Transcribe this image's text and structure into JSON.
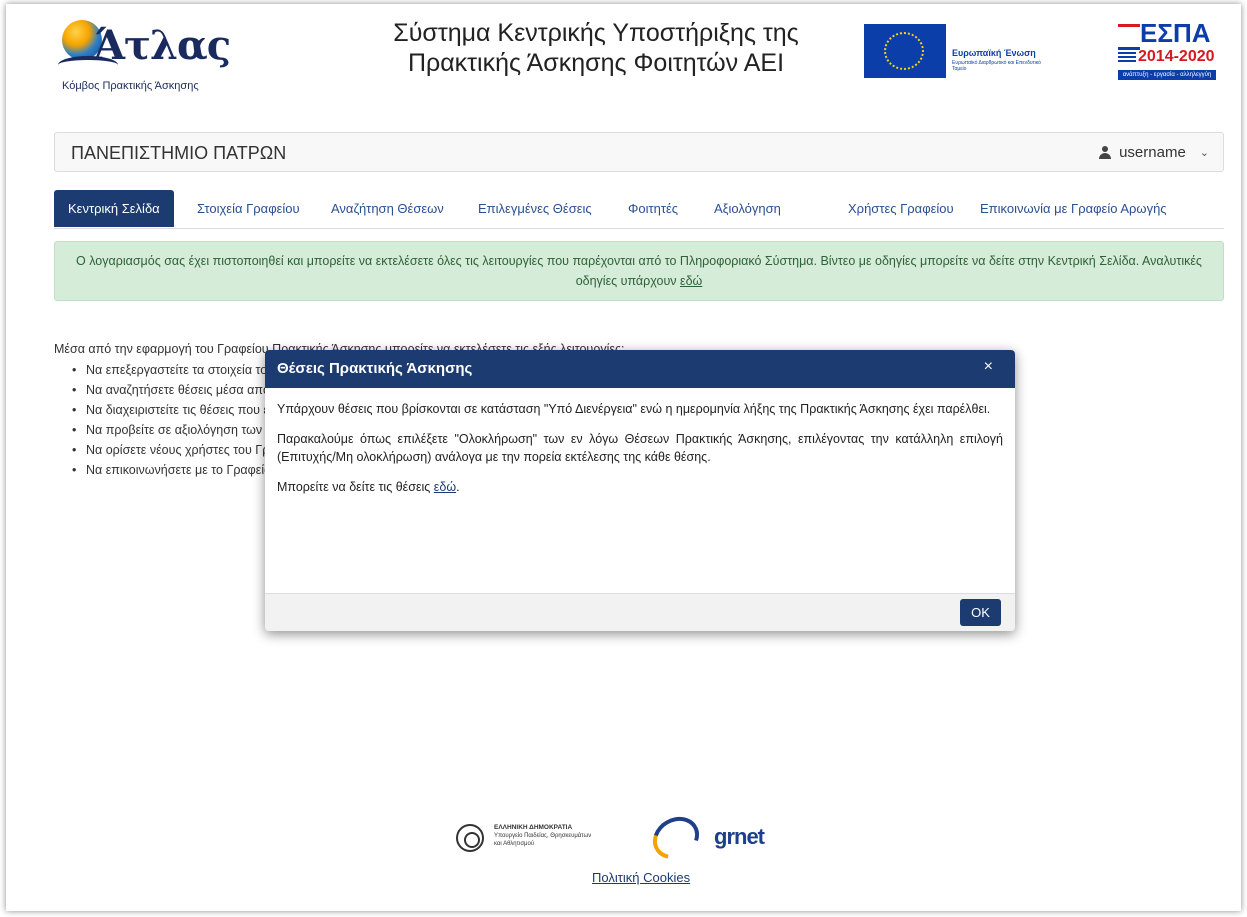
{
  "header": {
    "logo_name": "Άτλας",
    "logo_subtitle": "Κόμβος Πρακτικής Άσκησης",
    "title_line1": "Σύστημα Κεντρικής Υποστήριξης της",
    "title_line2": "Πρακτικής Άσκησης Φοιτητών ΑΕΙ",
    "eu_label": "Ευρωπαϊκή Ένωση",
    "eu_sublabel": "Ευρωπαϊκό Διαρθρωτικό και Επενδυτικό Ταμείο",
    "espa_name": "ΕΣΠΑ",
    "espa_years": "2014-2020",
    "espa_tagline": "ανάπτυξη - εργασία - αλληλεγγύη"
  },
  "university": {
    "name": "ΠΑΝΕΠΙΣΤΗΜΙΟ ΠΑΤΡΩΝ",
    "username": "username"
  },
  "tabs": [
    {
      "label": "Κεντρική Σελίδα",
      "active": true
    },
    {
      "label": "Στοιχεία Γραφείου",
      "active": false
    },
    {
      "label": "Αναζήτηση Θέσεων",
      "active": false
    },
    {
      "label": "Επιλεγμένες Θέσεις",
      "active": false
    },
    {
      "label": "Φοιτητές",
      "active": false
    },
    {
      "label": "Αξιολόγηση",
      "active": false
    },
    {
      "label": "Χρήστες Γραφείου",
      "active": false
    },
    {
      "label": "Επικοινωνία με Γραφείο Αρωγής",
      "active": false
    }
  ],
  "alert": {
    "text": "Ο λογαριασμός σας έχει πιστοποιηθεί και μπορείτε να εκτελέσετε όλες τις λειτουργίες που παρέχονται από το Πληροφοριακό Σύστημα. Βίντεο με οδηγίες μπορείτε να δείτε στην Κεντρική Σελίδα. Αναλυτικές οδηγίες υπάρχουν ",
    "link": "εδώ"
  },
  "main": {
    "intro": "Μέσα από την εφαρμογή του Γραφείου Πρακτικής Άσκησης μπορείτε να εκτελέσετε τις εξής λειτουργίες:",
    "functions": [
      "Να επεξεργαστείτε τα στοιχεία του Γραφείου",
      "Να αναζητήσετε θέσεις μέσα από τον Κόμβο",
      "Να διαχειριστείτε τις θέσεις που έχετε επιλέξει",
      "Να προβείτε σε αξιολόγηση των φορέων",
      "Να ορίσετε νέους χρήστες του Γραφείου",
      "Να επικοινωνήσετε με το Γραφείο Αρωγής"
    ]
  },
  "footer": {
    "gov_line1": "ΕΛΛΗΝΙΚΗ ΔΗΜΟΚΡΑΤΙΑ",
    "gov_line2": "Υπουργείο Παιδείας, Θρησκευμάτων",
    "gov_line3": "και Αθλητισμού",
    "grnet_a": "gr",
    "grnet_b": "net",
    "cookies": "Πολιτική Cookies"
  },
  "modal": {
    "title": "Θέσεις Πρακτικής Άσκησης",
    "close": "×",
    "p1": "Υπάρχουν θέσεις που βρίσκονται σε κατάσταση \"Υπό Διενέργεια\" ενώ η ημερομηνία λήξης της Πρακτικής Άσκησης έχει παρέλθει.",
    "p2": "Παρακαλούμε όπως επιλέξετε \"Ολοκλήρωση\" των εν λόγω Θέσεων Πρακτικής Άσκησης, επιλέγοντας την κατάλληλη επιλογή (Επιτυχής/Μη ολοκλήρωση) ανάλογα με την πορεία εκτέλεσης της κάθε θέσης.",
    "p3_prefix": "Μπορείτε να δείτε τις θέσεις ",
    "p3_link": "εδώ",
    "p3_suffix": ".",
    "ok": "OK"
  },
  "colors": {
    "primary": "#1c3b70",
    "alert_bg": "#d5ecd9",
    "alert_text": "#2e6137"
  }
}
